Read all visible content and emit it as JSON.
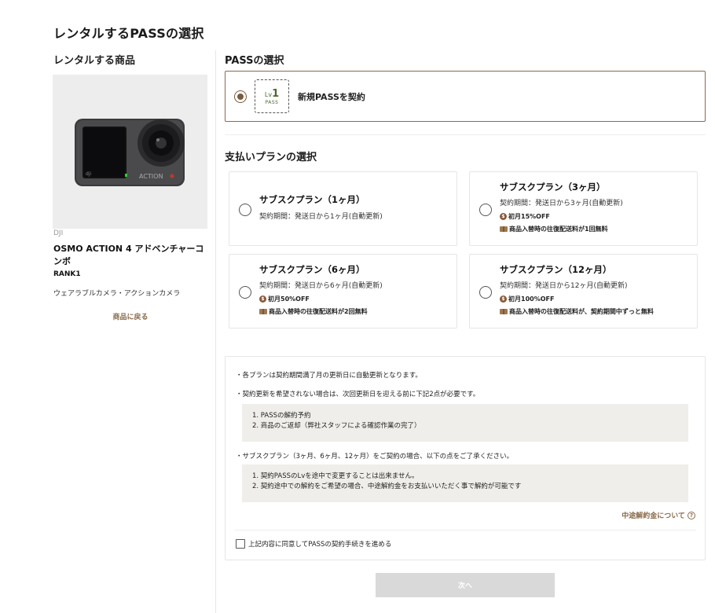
{
  "page": {
    "title": "レンタルするPASSの選択"
  },
  "product": {
    "heading": "レンタルする商品",
    "brand": "DJI",
    "name": "OSMO ACTION 4 アドベンチャーコンボ",
    "rank": "RANK1",
    "category": "ウェアラブルカメラ・アクションカメラ",
    "back_label": "商品に戻る"
  },
  "pass_section": {
    "title": "PASSの選択",
    "option": {
      "badge_lv": "Lv",
      "badge_num": "1",
      "badge_pass": "PASS",
      "label": "新規PASSを契約",
      "selected": true
    }
  },
  "plan_section": {
    "title": "支払いプランの選択",
    "plans": [
      {
        "name": "サブスクプラン（1ヶ月）",
        "period": "契約期間：発送日から1ヶ月(自動更新)",
        "perks": []
      },
      {
        "name": "サブスクプラン（3ヶ月）",
        "period": "契約期間：発送日から3ヶ月(自動更新)",
        "perks": [
          "初月15%OFF",
          "商品入替時の往復配送料が1回無料"
        ]
      },
      {
        "name": "サブスクプラン（6ヶ月）",
        "period": "契約期間：発送日から6ヶ月(自動更新)",
        "perks": [
          "初月50%OFF",
          "商品入替時の往復配送料が2回無料"
        ]
      },
      {
        "name": "サブスクプラン（12ヶ月）",
        "period": "契約期間：発送日から12ヶ月(自動更新)",
        "perks": [
          "初月100%OFF",
          "商品入替時の往復配送料が、契約期間中ずっと無料"
        ]
      }
    ]
  },
  "notes": {
    "note1": "・各プランは契約期間満了月の更新日に自動更新となります。",
    "note2": "・契約更新を希望されない場合は、次回更新日を迎える前に下記2点が必要です。",
    "box1": [
      "1. PASSの解約予約",
      "2. 商品のご返却（弊社スタッフによる確認作業の完了）"
    ],
    "note3": "・サブスクプラン（3ヶ月、6ヶ月、12ヶ月）をご契約の場合、以下の点をご了承ください。",
    "box2": [
      "1. 契約PASSのLvを途中で変更することは出来ません。",
      "2. 契約途中での解約をご希望の場合、中途解約金をお支払いいただく事で解約が可能です"
    ],
    "cancel_fee_link": "中途解約金について",
    "agree_label": "上記内容に同意してPASSの契約手続きを進める"
  },
  "actions": {
    "next_label": "次へ"
  },
  "colors": {
    "accent": "#8a6a4a",
    "disabled_button": "#d9d9d9",
    "note_box": "#efeeea"
  }
}
